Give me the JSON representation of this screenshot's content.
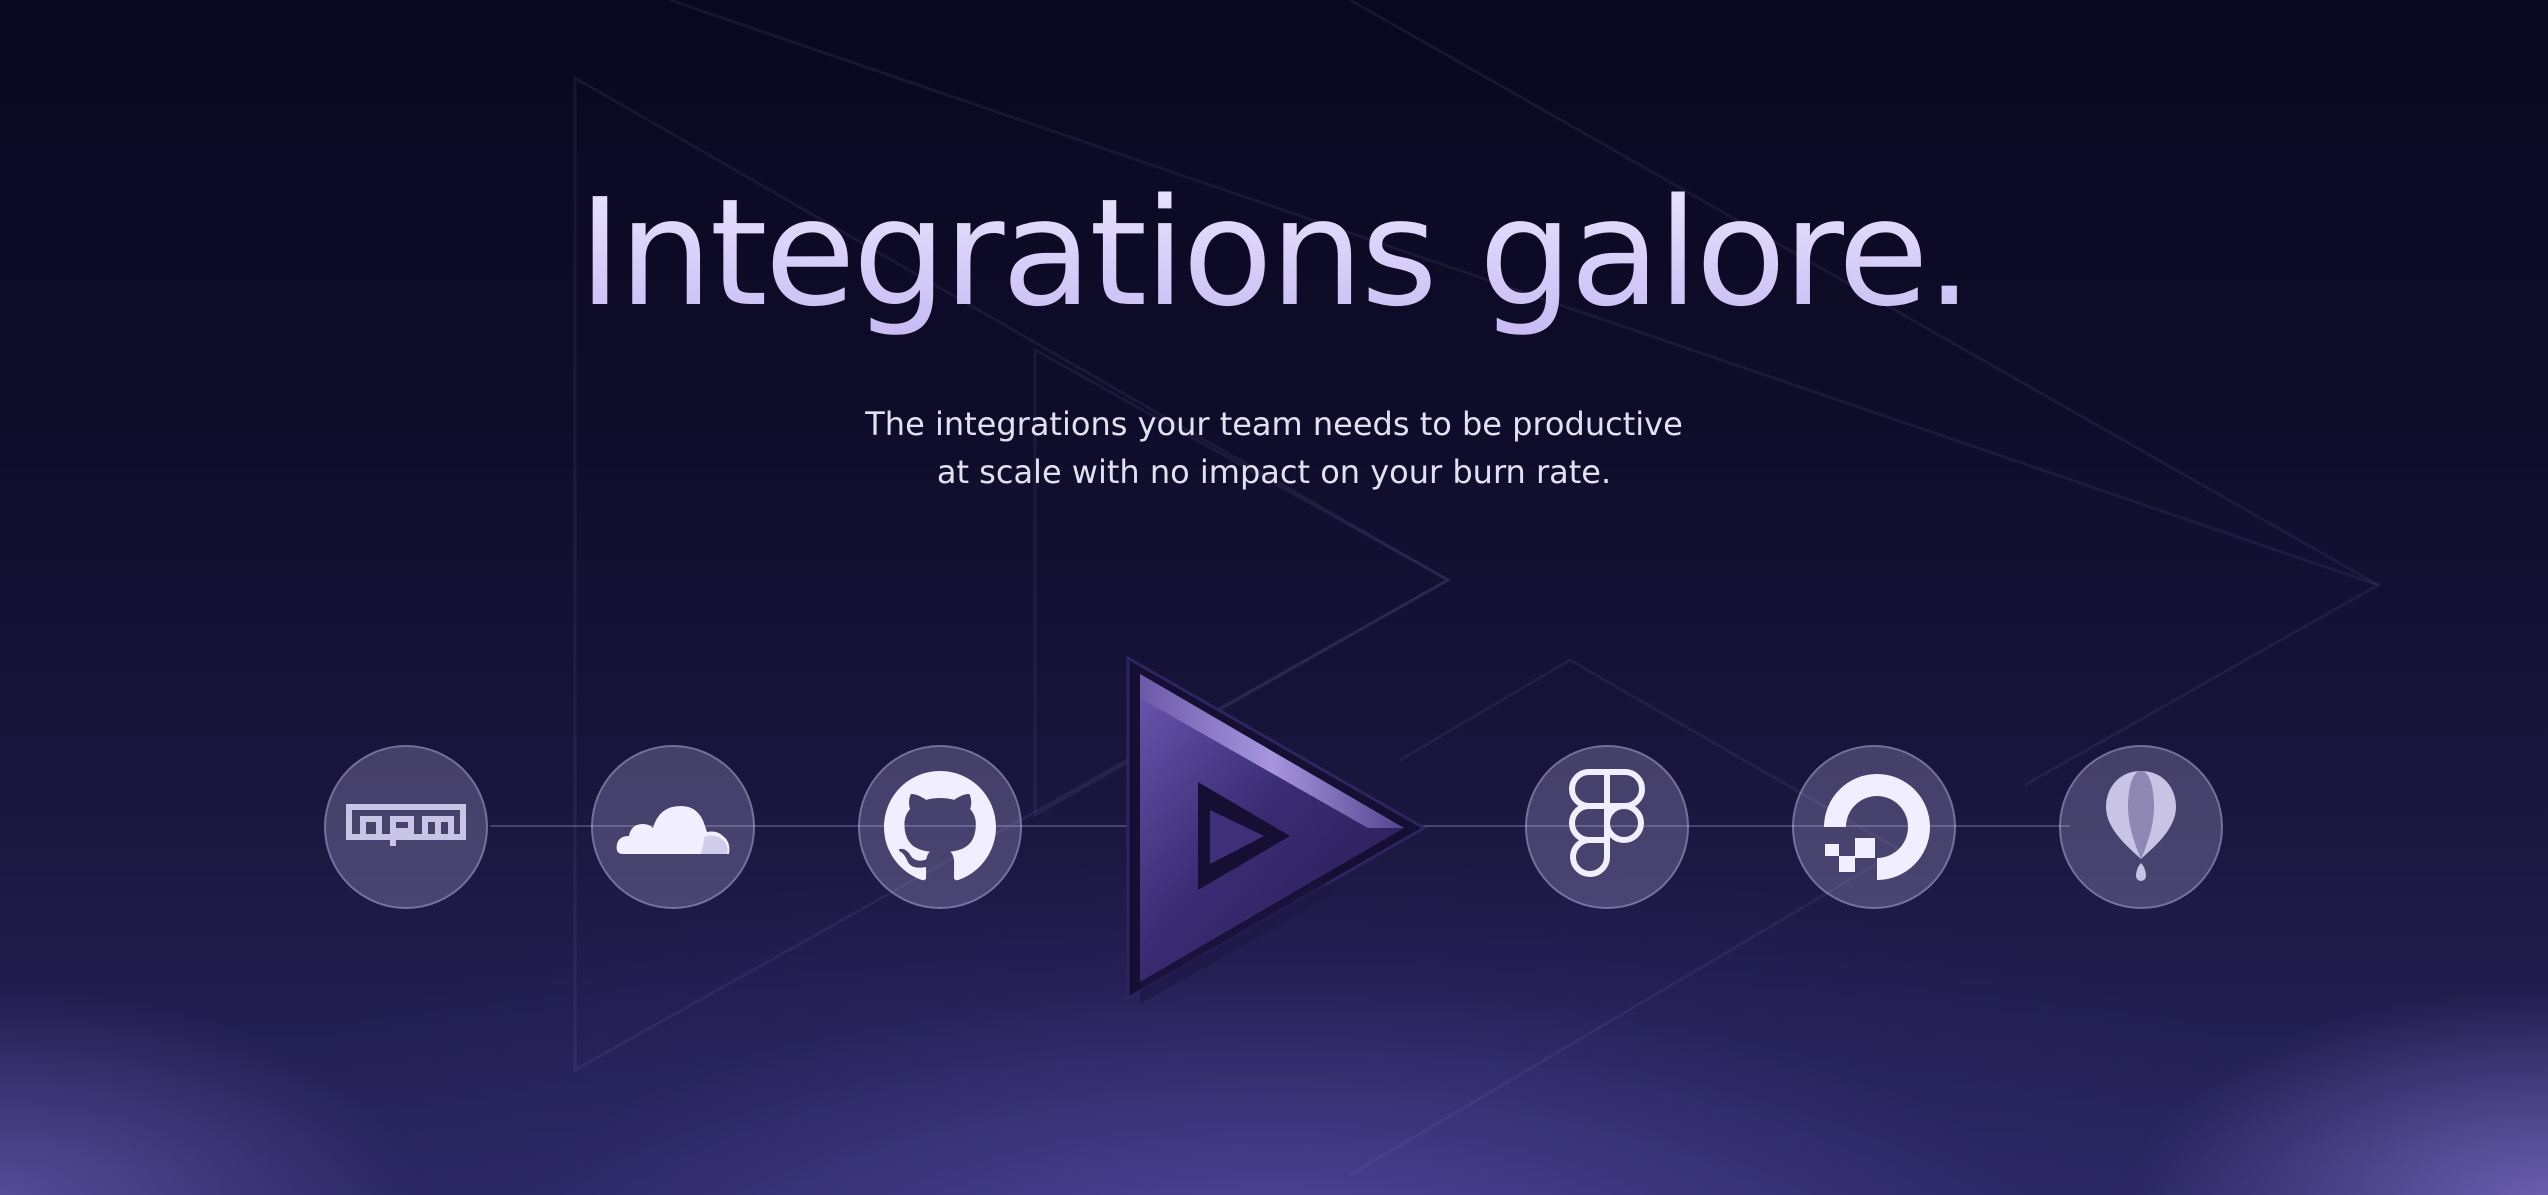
{
  "hero": {
    "title": "Integrations galore.",
    "subtitle_line1": "The integrations your team needs to be productive",
    "subtitle_line2": "at scale with no impact on your burn rate."
  },
  "integrations": [
    {
      "name": "npm",
      "icon": "npm-icon"
    },
    {
      "name": "Cloudflare",
      "icon": "cloudflare-icon"
    },
    {
      "name": "GitHub",
      "icon": "github-icon"
    },
    {
      "name": "Figma",
      "icon": "figma-icon"
    },
    {
      "name": "DigitalOcean",
      "icon": "digitalocean-icon"
    },
    {
      "name": "Balloon",
      "icon": "balloon-icon"
    }
  ],
  "center_logo": {
    "icon": "brand-play-icon"
  },
  "colors": {
    "background_top": "#0a0820",
    "background_bottom": "#2a2660",
    "title_gradient_start": "#ece8ff",
    "title_gradient_end": "#c6baf3",
    "subtitle": "#e3e0f2",
    "icon_fill": "#f0eeff",
    "brand_purple": "#5a4a9a"
  }
}
